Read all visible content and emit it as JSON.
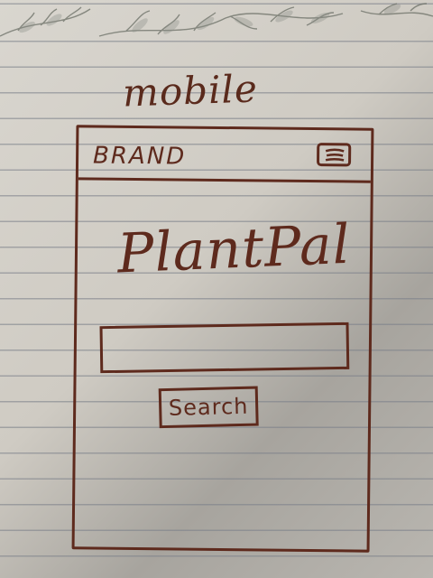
{
  "caption": "mobile",
  "header": {
    "brand": "BRAND",
    "menu_icon": "hamburger-menu-icon"
  },
  "main": {
    "title": "PlantPal",
    "search_button_label": "Search"
  },
  "colors": {
    "ink": "#5e2a1d",
    "paper": "#d4d1ca"
  }
}
